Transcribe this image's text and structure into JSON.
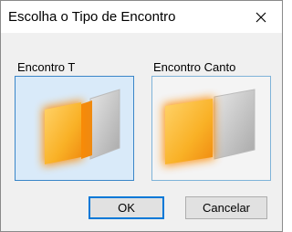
{
  "window": {
    "title": "Escolha o Tipo de Encontro"
  },
  "options": [
    {
      "label": "Encontro T",
      "selected": true,
      "icon": "t-junction-wall-icon"
    },
    {
      "label": "Encontro Canto",
      "selected": false,
      "icon": "corner-junction-wall-icon"
    }
  ],
  "buttons": {
    "ok_label": "OK",
    "cancel_label": "Cancelar"
  },
  "colors": {
    "accent": "#0078d7",
    "selected_fill": "#d9eaf9",
    "wall_orange": "#f7a21b"
  }
}
